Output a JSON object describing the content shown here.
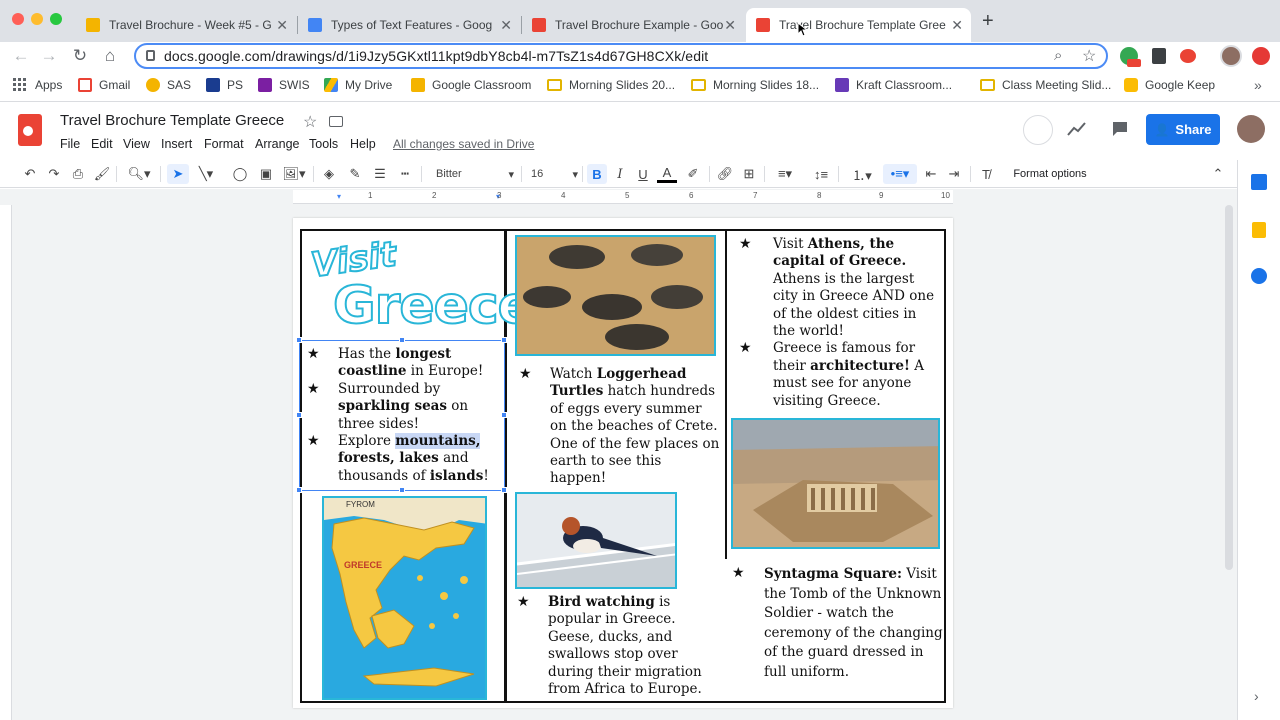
{
  "browser": {
    "tabs": [
      {
        "title": "Travel Brochure - Week #5 - G",
        "favicon_color": "#f4b400"
      },
      {
        "title": "Types of Text Features - Goog",
        "favicon_color": "#4285f4"
      },
      {
        "title": "Travel Brochure Example - Goo",
        "favicon_color": "#ea4335"
      },
      {
        "title": "Travel Brochure Template Gree",
        "favicon_color": "#ea4335"
      }
    ],
    "new_tab": "+",
    "url": "docs.google.com/drawings/d/1i9Jzy5GKxtl11kpt9dbY8cb4l-m7TsZ1s4d67GH8CXk/edit",
    "bookmarks": [
      {
        "label": "Apps",
        "icon": "apps-grid-icon",
        "color": "#5f6368"
      },
      {
        "label": "Gmail",
        "icon": "gmail-icon",
        "color": "#ea4335"
      },
      {
        "label": "SAS",
        "icon": "sas-icon",
        "color": "#f4b400"
      },
      {
        "label": "PS",
        "icon": "ps-icon",
        "color": "#1a3c8f"
      },
      {
        "label": "SWIS",
        "icon": "swis-icon",
        "color": "#7b1fa2"
      },
      {
        "label": "My Drive",
        "icon": "drive-icon",
        "color": "#34a853"
      },
      {
        "label": "Google Classroom",
        "icon": "classroom-icon",
        "color": "#f4b400"
      },
      {
        "label": "Morning Slides 20...",
        "icon": "folder-icon",
        "color": "#e2b400"
      },
      {
        "label": "Morning Slides 18...",
        "icon": "folder-icon",
        "color": "#e2b400"
      },
      {
        "label": "Kraft Classroom...",
        "icon": "form-icon",
        "color": "#673ab7"
      },
      {
        "label": "Class Meeting Slid...",
        "icon": "folder-icon",
        "color": "#e2b400"
      },
      {
        "label": "Google Keep",
        "icon": "keep-icon",
        "color": "#fbbc04"
      }
    ]
  },
  "docs": {
    "title": "Travel Brochure Template Greece",
    "menus": [
      "File",
      "Edit",
      "View",
      "Insert",
      "Format",
      "Arrange",
      "Tools",
      "Help"
    ],
    "saved_status": "All changes saved in Drive",
    "share_label": "Share",
    "font_name": "Bitter",
    "font_size": "16",
    "format_options": "Format options",
    "ruler_numbers": [
      "1",
      "2",
      "3",
      "4",
      "5",
      "6",
      "7",
      "8",
      "9",
      "10"
    ]
  },
  "brochure": {
    "visit": "Visit",
    "greece": "Greece",
    "col1_bullets": [
      {
        "parts": [
          [
            "n",
            "Has the "
          ],
          [
            "b",
            "longest coastline"
          ],
          [
            "n",
            " in Europe!"
          ]
        ]
      },
      {
        "parts": [
          [
            "n",
            "Surrounded by "
          ],
          [
            "b",
            "sparkling seas"
          ],
          [
            "n",
            " on three sides!"
          ]
        ]
      },
      {
        "parts": [
          [
            "n",
            "Explore "
          ],
          [
            "bh",
            "mountains,"
          ],
          [
            "n",
            " "
          ],
          [
            "b",
            "forests, lakes"
          ],
          [
            "n",
            " and thousands of "
          ],
          [
            "b",
            "islands"
          ],
          [
            "n",
            "!"
          ]
        ]
      }
    ],
    "map_labels": {
      "fyrom": "FYROM",
      "greece": "GREECE"
    },
    "turtles": {
      "parts": [
        [
          "n",
          "Watch "
        ],
        [
          "b",
          "Loggerhead Turtles"
        ],
        [
          "n",
          " hatch hundreds of eggs every summer on the beaches of Crete. One of the few places on earth to see this happen!"
        ]
      ]
    },
    "birds": {
      "parts": [
        [
          "b",
          "Bird watching"
        ],
        [
          "n",
          " is popular in Greece. Geese, ducks, and swallows stop over during their migration from Africa to Europe."
        ]
      ]
    },
    "col3_bullets": [
      {
        "parts": [
          [
            "n",
            "Visit "
          ],
          [
            "b",
            "Athens, the capital of Greece."
          ],
          [
            "n",
            " Athens is the largest city in Greece AND one of the oldest cities in the world!"
          ]
        ]
      },
      {
        "parts": [
          [
            "n",
            "Greece is famous for their "
          ],
          [
            "b",
            "architecture!"
          ],
          [
            "n",
            "  A must see for anyone visiting Greece."
          ]
        ]
      }
    ],
    "syntagma": {
      "parts": [
        [
          "b",
          "Syntagma Square:"
        ],
        [
          "n",
          " Visit the Tomb of the Unknown Soldier - watch the ceremony of the changing of the guard dressed in full uniform."
        ]
      ]
    }
  }
}
